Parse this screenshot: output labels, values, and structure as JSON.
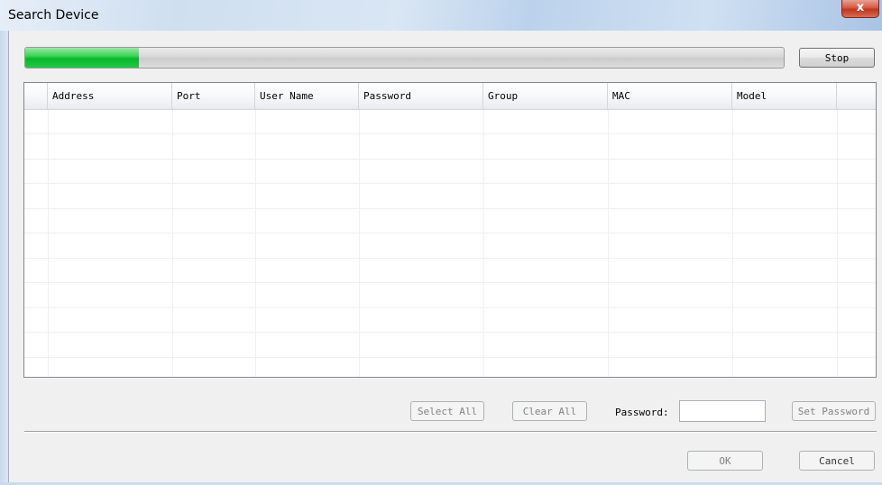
{
  "window": {
    "title": "Search Device",
    "close_glyph": "x"
  },
  "progress": {
    "value_fraction": 0.15,
    "fill_color": "#06b82a"
  },
  "buttons": {
    "stop": "Stop",
    "select_all": "Select All",
    "clear_all": "Clear All",
    "set_password": "Set Password",
    "ok": "OK",
    "cancel": "Cancel"
  },
  "table": {
    "columns": [
      "Address",
      "Port",
      "User Name",
      "Password",
      "Group",
      "MAC",
      "Model"
    ],
    "rows": []
  },
  "password_field": {
    "label": "Password:",
    "value": ""
  }
}
